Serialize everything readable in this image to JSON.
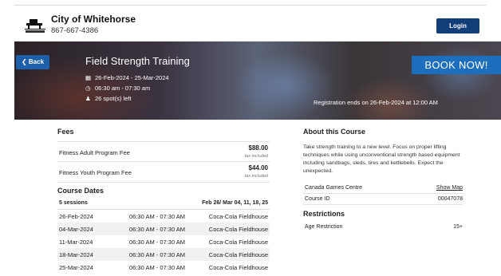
{
  "header": {
    "org_name": "City of Whitehorse",
    "phone": "867-667-4386",
    "login_label": "Login",
    "login_color": "#123f7a",
    "logo_text": "Whitehorse"
  },
  "hero": {
    "back_label": "Back",
    "title": "Field Strength Training",
    "date_range": "26-Feb-2024 - 25-Mar-2024",
    "time_range": "06:30 am - 07:30 am",
    "spots_left": "26 spot(s) left",
    "book_label": "BOOK NOW!",
    "book_color": "#1d6fbd",
    "registration_ends": "Registration ends on 26-Feb-2024 at 12:00 AM",
    "icons": [
      "calendar-icon",
      "clock-icon",
      "person-icon",
      "chevron-left-icon"
    ]
  },
  "fees": {
    "title": "Fees",
    "items": [
      {
        "name": "Fitness Adult Program Fee",
        "amount": "$88.00",
        "tax_note": "tax included"
      },
      {
        "name": "Fitness Youth Program Fee",
        "amount": "$44.00",
        "tax_note": "tax included"
      }
    ]
  },
  "course_dates": {
    "title": "Course Dates",
    "sessions_label": "5 sessions",
    "sessions_summary": "Feb 26/ Mar 04, 11, 18, 25",
    "rows": [
      {
        "date": "26-Feb-2024",
        "time": "06:30 AM - 07:30 AM",
        "location": "Coca-Cola Fieldhouse"
      },
      {
        "date": "04-Mar-2024",
        "time": "06:30 AM - 07:30 AM",
        "location": "Coca-Cola Fieldhouse"
      },
      {
        "date": "11-Mar-2024",
        "time": "06:30 AM - 07:30 AM",
        "location": "Coca-Cola Fieldhouse"
      },
      {
        "date": "18-Mar-2024",
        "time": "06:30 AM - 07:30 AM",
        "location": "Coca-Cola Fieldhouse"
      },
      {
        "date": "25-Mar-2024",
        "time": "06:30 AM - 07:30 AM",
        "location": "Coca-Cola Fieldhouse"
      }
    ]
  },
  "about": {
    "title": "About this Course",
    "description": "Take strength training to a new level. Focus on proper lifting techniques while using unconventional strength based equipment including sandbags, sleds, tires and kettlebells. Expect the unexpected.",
    "facility": "Canada Games Centre",
    "show_map_label": "Show Map",
    "course_id_label": "Course ID",
    "course_id": "00047078"
  },
  "restrictions": {
    "title": "Restrictions",
    "age_label": "Age Restriction",
    "age_value": "15+"
  }
}
